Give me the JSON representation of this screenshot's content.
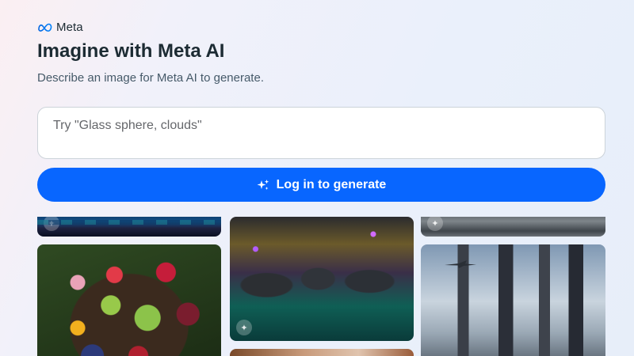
{
  "brand": {
    "name": "Meta",
    "icon": "meta-infinity-icon"
  },
  "header": {
    "title": "Imagine with Meta AI",
    "subtitle": "Describe an image for Meta AI to generate."
  },
  "prompt": {
    "placeholder": "Try \"Glass sphere, clouds\"",
    "value": ""
  },
  "generate_button": {
    "label": "Log in to generate",
    "icon": "sparkle-icon"
  },
  "colors": {
    "accent": "#0866ff",
    "text": "#1c2b33",
    "subtext": "#465a69"
  },
  "gallery": {
    "items": [
      {
        "name": "aurora-image"
      },
      {
        "name": "water-image"
      },
      {
        "name": "fruit-platter-image"
      },
      {
        "name": "space-cats-image"
      },
      {
        "name": "futuristic-city-image"
      },
      {
        "name": "warm-tone-image"
      }
    ],
    "badge_icon": "ai-sparkle-badge-icon"
  }
}
